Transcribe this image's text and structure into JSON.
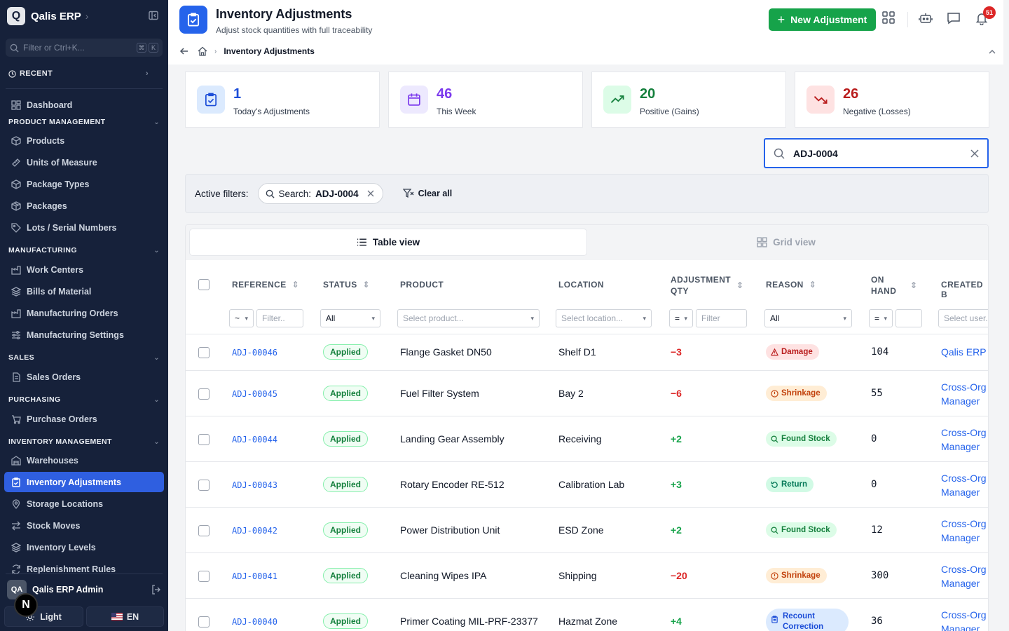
{
  "app": {
    "name": "Qalis ERP",
    "logo_letter": "Q"
  },
  "sidebar": {
    "filter_placeholder": "Filter or Ctrl+K...",
    "filter_keys": [
      "⌘",
      "K"
    ],
    "recent_label": "RECENT",
    "dashboard": "Dashboard",
    "sections": {
      "product": "PRODUCT MANAGEMENT",
      "manufacturing": "MANUFACTURING",
      "sales": "SALES",
      "purchasing": "PURCHASING",
      "inventory": "INVENTORY MANAGEMENT"
    },
    "items": {
      "products": "Products",
      "uom": "Units of Measure",
      "package_types": "Package Types",
      "packages": "Packages",
      "lots": "Lots / Serial Numbers",
      "work_centers": "Work Centers",
      "bom": "Bills of Material",
      "mo": "Manufacturing Orders",
      "mfg_settings": "Manufacturing Settings",
      "sales_orders": "Sales Orders",
      "purchase_orders": "Purchase Orders",
      "warehouses": "Warehouses",
      "inv_adjustments": "Inventory Adjustments",
      "storage_locations": "Storage Locations",
      "stock_moves": "Stock Moves",
      "inventory_levels": "Inventory Levels",
      "replenishment": "Replenishment Rules"
    },
    "user": {
      "initials": "QA",
      "name": "Qalis ERP Admin"
    },
    "n_badge": "N",
    "theme_label": "Light",
    "lang_label": "EN"
  },
  "header": {
    "title": "Inventory Adjustments",
    "subtitle": "Adjust stock quantities with full traceability",
    "new_button": "New Adjustment",
    "notif_count": "51",
    "breadcrumb_current": "Inventory Adjustments"
  },
  "stats": [
    {
      "value": "1",
      "label": "Today's Adjustments",
      "color": "#1d4ed8"
    },
    {
      "value": "46",
      "label": "This Week",
      "color": "#7c3aed"
    },
    {
      "value": "20",
      "label": "Positive (Gains)",
      "color": "#15803d"
    },
    {
      "value": "26",
      "label": "Negative (Losses)",
      "color": "#b91c1c"
    }
  ],
  "search": {
    "value": "ADJ-0004"
  },
  "filters": {
    "label": "Active filters:",
    "chip_key": "Search:",
    "chip_value": "ADJ-0004",
    "clear_all": "Clear all"
  },
  "views": {
    "table": "Table view",
    "grid": "Grid view"
  },
  "table": {
    "headers": {
      "reference": "REFERENCE",
      "status": "STATUS",
      "product": "PRODUCT",
      "location": "LOCATION",
      "adj_qty_1": "ADJUSTMENT",
      "adj_qty_2": "QTY",
      "reason": "REASON",
      "on_hand_1": "ON",
      "on_hand_2": "HAND",
      "created_by": "CREATED B"
    },
    "filters": {
      "ref_op": "~",
      "ref_placeholder": "Filter..",
      "status_value": "All",
      "product_placeholder": "Select product...",
      "location_placeholder": "Select location...",
      "qty_op": "=",
      "qty_placeholder": "Filter",
      "reason_value": "All",
      "onhand_op": "=",
      "user_placeholder": "Select user..."
    },
    "rows": [
      {
        "ref": "ADJ-00046",
        "status": "Applied",
        "product": "Flange Gasket DN50",
        "location": "Shelf D1",
        "qty": "−3",
        "reason": "Damage",
        "on_hand": "104",
        "created_1": "Qalis ERP A",
        "created_2": ""
      },
      {
        "ref": "ADJ-00045",
        "status": "Applied",
        "product": "Fuel Filter System",
        "location": "Bay 2",
        "qty": "−6",
        "reason": "Shrinkage",
        "on_hand": "55",
        "created_1": "Cross-Org",
        "created_2": "Manager"
      },
      {
        "ref": "ADJ-00044",
        "status": "Applied",
        "product": "Landing Gear Assembly",
        "location": "Receiving",
        "qty": "+2",
        "reason": "Found Stock",
        "on_hand": "0",
        "created_1": "Cross-Org",
        "created_2": "Manager"
      },
      {
        "ref": "ADJ-00043",
        "status": "Applied",
        "product": "Rotary Encoder RE-512",
        "location": "Calibration Lab",
        "qty": "+3",
        "reason": "Return",
        "on_hand": "0",
        "created_1": "Cross-Org",
        "created_2": "Manager"
      },
      {
        "ref": "ADJ-00042",
        "status": "Applied",
        "product": "Power Distribution Unit",
        "location": "ESD Zone",
        "qty": "+2",
        "reason": "Found Stock",
        "on_hand": "12",
        "created_1": "Cross-Org",
        "created_2": "Manager"
      },
      {
        "ref": "ADJ-00041",
        "status": "Applied",
        "product": "Cleaning Wipes IPA",
        "location": "Shipping",
        "qty": "−20",
        "reason": "Shrinkage",
        "on_hand": "300",
        "created_1": "Cross-Org",
        "created_2": "Manager"
      },
      {
        "ref": "ADJ-00040",
        "status": "Applied",
        "product": "Primer Coating MIL-PRF-23377",
        "location": "Hazmat Zone",
        "qty": "+4",
        "reason_1": "Recount",
        "reason_2": "Correction",
        "on_hand": "36",
        "created_1": "Cross-Org",
        "created_2": "Manager"
      }
    ]
  }
}
